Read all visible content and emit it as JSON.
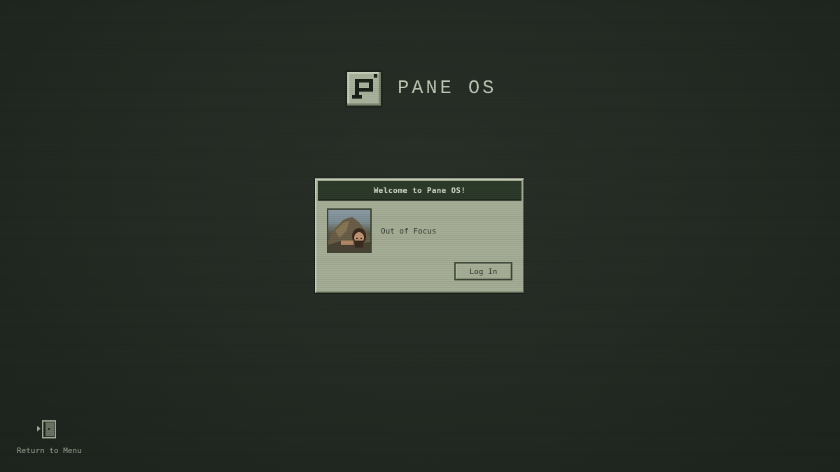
{
  "logo": {
    "icon": "pane-os-logo-icon",
    "text": "PANE OS"
  },
  "login_window": {
    "title": "Welcome to Pane OS!",
    "user": {
      "avatar": "user-avatar",
      "name": "Out of Focus"
    },
    "login_button_label": "Log In"
  },
  "return_to_menu": {
    "icon": "door-exit-icon",
    "label": "Return to Menu"
  },
  "colors": {
    "background": "#252c25",
    "window_body": "#a6ae97",
    "titlebar": "#2c3a2a",
    "text_light": "#c5cbb8"
  }
}
